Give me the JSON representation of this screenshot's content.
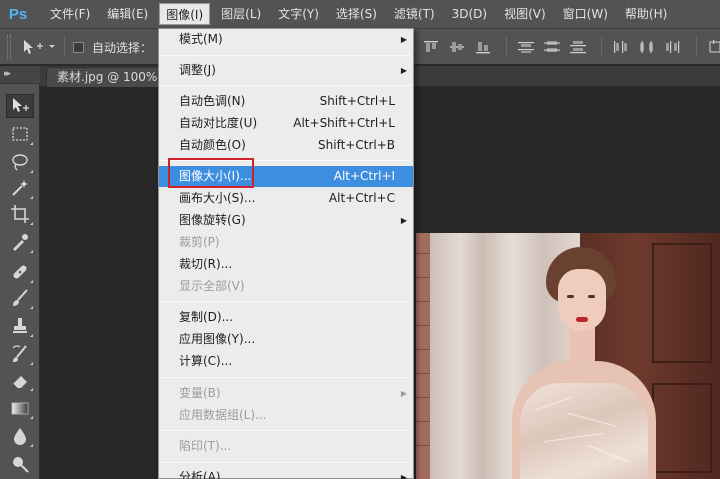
{
  "menubar": {
    "logo": "Ps",
    "items": [
      "文件(F)",
      "编辑(E)",
      "图像(I)",
      "图层(L)",
      "文字(Y)",
      "选择(S)",
      "滤镜(T)",
      "3D(D)",
      "视图(V)",
      "窗口(W)",
      "帮助(H)"
    ],
    "active_index": 2
  },
  "options": {
    "auto_select_label": "自动选择："
  },
  "document_tab": {
    "label": "素材.jpg @ 100%("
  },
  "image_menu": {
    "items": [
      {
        "label": "模式(M)",
        "shortcut": "",
        "submenu": true,
        "disabled": false
      },
      {
        "label": "调整(J)",
        "shortcut": "",
        "submenu": true,
        "disabled": false
      },
      {
        "label": "自动色调(N)",
        "shortcut": "Shift+Ctrl+L",
        "submenu": false,
        "disabled": false
      },
      {
        "label": "自动对比度(U)",
        "shortcut": "Alt+Shift+Ctrl+L",
        "submenu": false,
        "disabled": false
      },
      {
        "label": "自动颜色(O)",
        "shortcut": "Shift+Ctrl+B",
        "submenu": false,
        "disabled": false
      },
      {
        "label": "图像大小(I)...",
        "shortcut": "Alt+Ctrl+I",
        "submenu": false,
        "disabled": false,
        "highlighted": true
      },
      {
        "label": "画布大小(S)...",
        "shortcut": "Alt+Ctrl+C",
        "submenu": false,
        "disabled": false
      },
      {
        "label": "图像旋转(G)",
        "shortcut": "",
        "submenu": true,
        "disabled": false
      },
      {
        "label": "裁剪(P)",
        "shortcut": "",
        "submenu": false,
        "disabled": true
      },
      {
        "label": "裁切(R)...",
        "shortcut": "",
        "submenu": false,
        "disabled": false
      },
      {
        "label": "显示全部(V)",
        "shortcut": "",
        "submenu": false,
        "disabled": true
      },
      {
        "label": "复制(D)...",
        "shortcut": "",
        "submenu": false,
        "disabled": false
      },
      {
        "label": "应用图像(Y)...",
        "shortcut": "",
        "submenu": false,
        "disabled": false
      },
      {
        "label": "计算(C)...",
        "shortcut": "",
        "submenu": false,
        "disabled": false
      },
      {
        "label": "变量(B)",
        "shortcut": "",
        "submenu": true,
        "disabled": true
      },
      {
        "label": "应用数据组(L)...",
        "shortcut": "",
        "submenu": false,
        "disabled": true
      },
      {
        "label": "陷印(T)...",
        "shortcut": "",
        "submenu": false,
        "disabled": true
      },
      {
        "label": "分析(A)",
        "shortcut": "",
        "submenu": true,
        "disabled": false
      }
    ]
  },
  "colors": {
    "highlight": "#3d8ee0",
    "annotation_box": "#d0202a",
    "ps_logo": "#4fb3f5"
  }
}
